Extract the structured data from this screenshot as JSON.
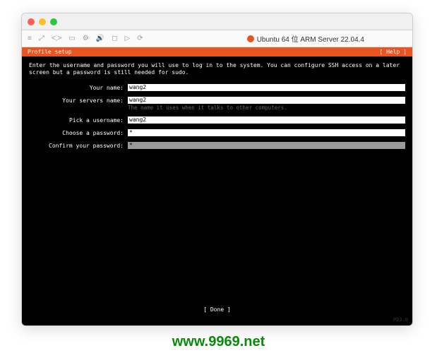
{
  "vm_title": "Ubuntu 64 位 ARM Server 22.04.4",
  "header": {
    "title": "Profile setup",
    "help": "[ Help ]"
  },
  "intro": "Enter the username and password you will use to log in to the system. You can configure SSH access on a later screen but a password is still needed for sudo.",
  "fields": {
    "name": {
      "label": "Your name:",
      "value": "wang2"
    },
    "server": {
      "label": "Your servers name:",
      "value": "wang2",
      "hint": "The name it uses when it talks to other computers."
    },
    "username": {
      "label": "Pick a username:",
      "value": "wang2"
    },
    "password": {
      "label": "Choose a password:",
      "value": "*"
    },
    "confirm": {
      "label": "Confirm your password:",
      "value": "*"
    }
  },
  "footer": {
    "done": "[ Done       ]"
  },
  "watermark": "www.9969.net",
  "vm_watermark": "PD3.0"
}
